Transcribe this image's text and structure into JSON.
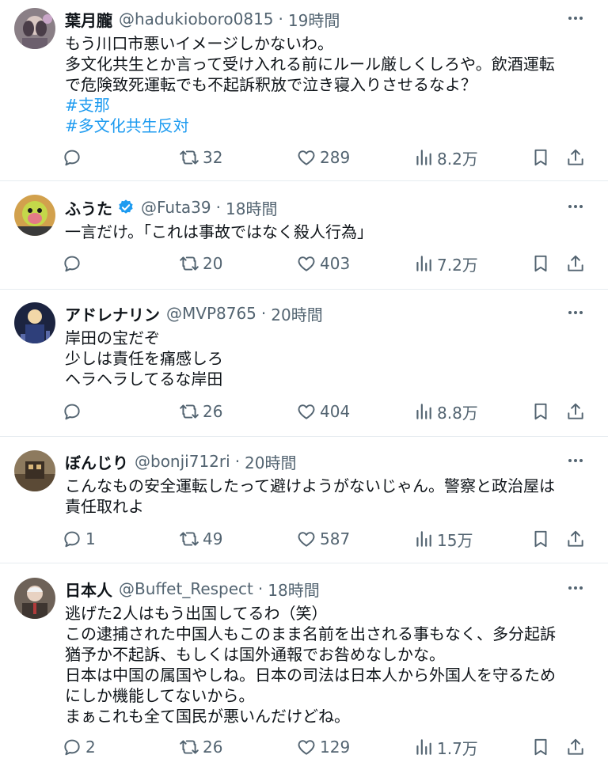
{
  "tweets": [
    {
      "name": "葉月朧",
      "handle": "@hadukioboro0815",
      "sep": "·",
      "time": "19時間",
      "verified": false,
      "lines": [
        "もう川口市悪いイメージしかないわ。",
        "多文化共生とか言って受け入れる前にルール厳しくしろや。飲酒運転",
        "で危険致死運転でも不起訴釈放で泣き寝入りさせるなよ？"
      ],
      "hashtags": [
        "#支那",
        "#多文化共生反対"
      ],
      "replies": "",
      "retweets": "32",
      "likes": "289",
      "views": "8.2万"
    },
    {
      "name": "ふうた",
      "handle": "@Futa39",
      "sep": "·",
      "time": "18時間",
      "verified": true,
      "lines": [
        "一言だけ。「これは事故ではなく殺人行為」"
      ],
      "hashtags": [],
      "replies": "",
      "retweets": "20",
      "likes": "403",
      "views": "7.2万"
    },
    {
      "name": "アドレナリン",
      "handle": "@MVP8765",
      "sep": "·",
      "time": "20時間",
      "verified": false,
      "lines": [
        "岸田の宝だぞ",
        "少しは責任を痛感しろ",
        "ヘラヘラしてるな岸田"
      ],
      "hashtags": [],
      "replies": "",
      "retweets": "26",
      "likes": "404",
      "views": "8.8万"
    },
    {
      "name": "ぼんじり",
      "handle": "@bonji712ri",
      "sep": "·",
      "time": "20時間",
      "verified": false,
      "lines": [
        "こんなもの安全運転したって避けようがないじゃん。警察と政治屋は",
        "責任取れよ"
      ],
      "hashtags": [],
      "replies": "1",
      "retweets": "49",
      "likes": "587",
      "views": "15万"
    },
    {
      "name": "日本人",
      "handle": "@Buffet_Respect",
      "sep": "·",
      "time": "18時間",
      "verified": false,
      "lines": [
        "逃げた2人はもう出国してるわ（笑）",
        "この逮捕された中国人もこのまま名前を出される事もなく、多分起訴",
        "猶予か不起訴、もしくは国外通報でお咎めなしかな。",
        "日本は中国の属国やしね。日本の司法は日本人から外国人を守るため",
        "にしか機能してないから。",
        "まぁこれも全て国民が悪いんだけどね。"
      ],
      "hashtags": [],
      "replies": "2",
      "retweets": "26",
      "likes": "129",
      "views": "1.7万"
    }
  ],
  "icons": {
    "reply": "reply-icon",
    "retweet": "retweet-icon",
    "like": "heart-icon",
    "views": "views-icon",
    "bookmark": "bookmark-icon",
    "share": "share-icon",
    "more": "more-icon",
    "verified": "verified-badge-icon"
  },
  "colors": {
    "text": "#0f1419",
    "secondary": "#536471",
    "hashtag": "#1d9bf0",
    "verified": "#1d9bf0",
    "divider": "#e6ecf0"
  }
}
